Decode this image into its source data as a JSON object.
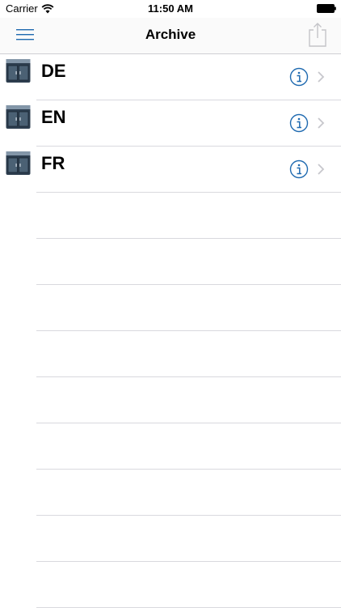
{
  "status_bar": {
    "carrier": "Carrier",
    "time": "11:50 AM",
    "icons": [
      "wifi-icon",
      "battery-icon"
    ]
  },
  "nav": {
    "title": "Archive",
    "left_icon": "hamburger-menu-icon",
    "right_icon": "share-icon"
  },
  "archives": [
    {
      "label": "DE",
      "icon": "cabinet-icon"
    },
    {
      "label": "EN",
      "icon": "cabinet-icon"
    },
    {
      "label": "FR",
      "icon": "cabinet-icon"
    }
  ],
  "colors": {
    "accent": "#1f6ab0",
    "chevron": "#c7c7cc",
    "separator": "#d9d9de"
  }
}
